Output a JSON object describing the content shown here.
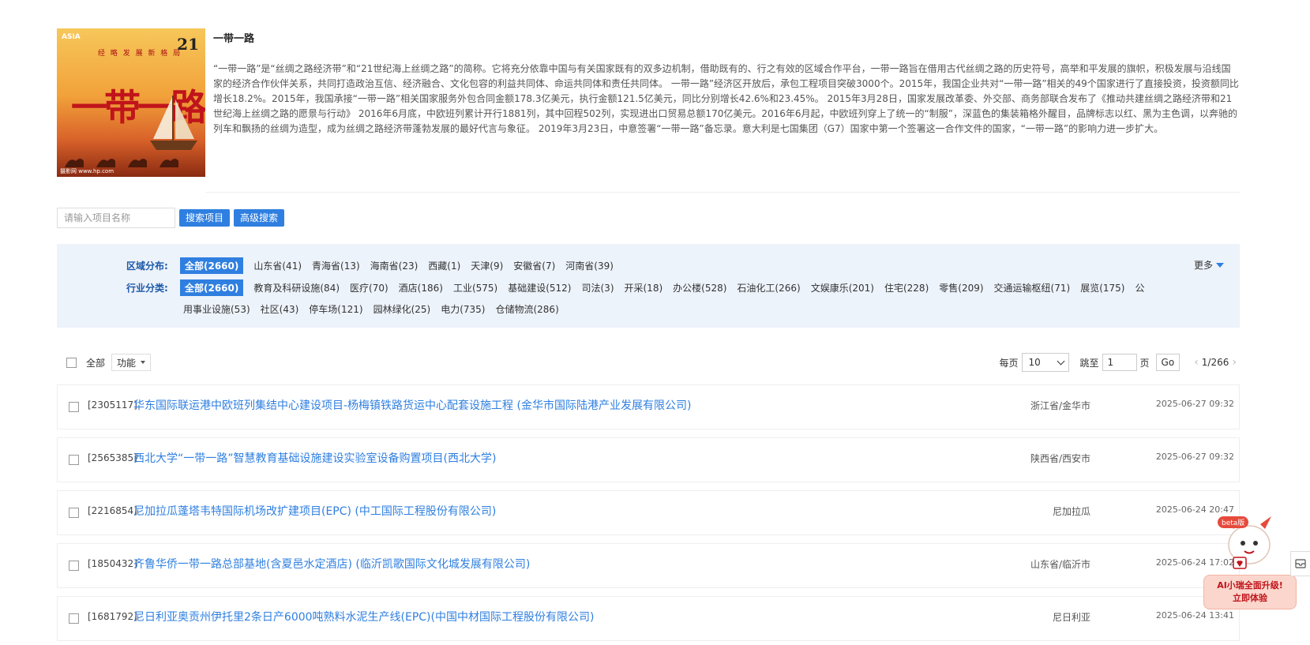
{
  "intro": {
    "cover_asia_text": "ASIA",
    "cover_top_text": "经 略 发 展 新 格 局",
    "cover_badge": "21",
    "cover_calligraphy": "一带一路",
    "cover_bottom_text": "摄影网 www.hp.com",
    "title": "一带一路",
    "description": "“一带一路”是“丝绸之路经济带”和“21世纪海上丝绸之路”的简称。它将充分依靠中国与有关国家既有的双多边机制，借助既有的、行之有效的区域合作平台，一带一路旨在借用古代丝绸之路的历史符号，高举和平发展的旗帜，积极发展与沿线国家的经济合作伙伴关系，共同打造政治互信、经济融合、文化包容的利益共同体、命运共同体和责任共同体。 一带一路”经济区开放后，承包工程项目突破3000个。2015年，我国企业共对“一带一路”相关的49个国家进行了直接投资，投资额同比增长18.2%。2015年，我国承接“一带一路”相关国家服务外包合同金额178.3亿美元，执行金额121.5亿美元，同比分别增长42.6%和23.45%。 2015年3月28日，国家发展改革委、外交部、商务部联合发布了《推动共建丝绸之路经济带和21世纪海上丝绸之路的愿景与行动》 2016年6月底，中欧班列累计开行1881列，其中回程502列，实现进出口贸易总额170亿美元。2016年6月起，中欧班列穿上了统一的“制服”，深蓝色的集装箱格外醒目，品牌标志以红、黑为主色调，以奔驰的列车和飘扬的丝绸为造型，成为丝绸之路经济带蓬勃发展的最好代言与象征。 2019年3月23日，中意签署“一带一路”备忘录。意大利是七国集团（G7）国家中第一个签署这一合作文件的国家，“一带一路”的影响力进一步扩大。"
  },
  "search": {
    "placeholder": "请输入项目名称",
    "search_button": "搜索项目",
    "advanced_button": "高级搜索"
  },
  "filter": {
    "region_label": "区域分布:",
    "regions": [
      "全部(2660)",
      "山东省(41)",
      "青海省(13)",
      "海南省(23)",
      "西藏(1)",
      "天津(9)",
      "安徽省(7)",
      "河南省(39)"
    ],
    "more_label": "更多",
    "industry_label": "行业分类:",
    "industries_row1": [
      "全部(2660)",
      "教育及科研设施(84)",
      "医疗(70)",
      "酒店(186)",
      "工业(575)",
      "基础建设(512)",
      "司法(3)",
      "开采(18)",
      "办公楼(528)",
      "石油化工(266)",
      "文娱康乐(201)",
      "住宅(228)",
      "零售(209)",
      "交通运输枢纽(71)",
      "展览(175)",
      "公"
    ],
    "industries_row2": [
      "用事业设施(53)",
      "社区(43)",
      "停车场(121)",
      "园林绿化(25)",
      "电力(735)",
      "仓储物流(286)"
    ]
  },
  "toolbar": {
    "select_all": "全部",
    "function_button": "功能",
    "per_page_label": "每页",
    "per_page_value": "10",
    "jump_label": "跳至",
    "jump_value": "1",
    "page_unit": "页",
    "go_button": "Go",
    "page_indicator": "1/266"
  },
  "projects": [
    {
      "code": "[2305117]",
      "title": "华东国际联运港中欧班列集结中心建设项目-杨梅镇铁路货运中心配套设施工程 (金华市国际陆港产业发展有限公司)",
      "region": "浙江省/金华市",
      "time": "2025-06-27 09:32"
    },
    {
      "code": "[2565385]",
      "title": "西北大学“一带一路”智慧教育基础设施建设实验室设备购置项目(西北大学)",
      "region": "陕西省/西安市",
      "time": "2025-06-27 09:32"
    },
    {
      "code": "[2216854]",
      "title": "尼加拉瓜蓬塔韦特国际机场改扩建项目(EPC) (中工国际工程股份有限公司)",
      "region": "尼加拉瓜",
      "time": "2025-06-24 20:47"
    },
    {
      "code": "[1850432]",
      "title": "齐鲁华侨一带一路总部基地(含夏邑水定酒店) (临沂凯歌国际文化城发展有限公司)",
      "region": "山东省/临沂市",
      "time": "2025-06-24 17:02"
    },
    {
      "code": "[1681792]",
      "title": "尼日利亚奥贡州伊托里2条日产6000吨熟料水泥生产线(EPC)(中国中材国际工程股份有限公司)",
      "region": "尼日利亚",
      "time": "2025-06-24 13:41"
    }
  ],
  "ai_widget": {
    "beta": "beta版",
    "line1": "AI小瑞全面升级!",
    "line2": "立即体验"
  }
}
